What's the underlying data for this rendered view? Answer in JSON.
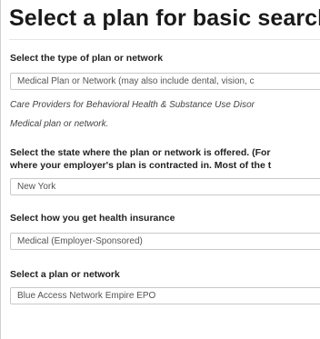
{
  "heading": "Select a plan for basic search",
  "plan_type": {
    "label": "Select the type of plan or network",
    "value": "Medical Plan or Network (may also include dental, vision, c"
  },
  "notes": {
    "line1": "Care Providers for Behavioral Health & Substance Use Disor",
    "line2": "Medical plan or network."
  },
  "state": {
    "label_line1": "Select the state where the plan or network is offered. (For",
    "label_line2": "where your employer's plan is contracted in. Most of the t",
    "value": "New York"
  },
  "insurance_source": {
    "label": "Select how you get health insurance",
    "value": "Medical (Employer-Sponsored)"
  },
  "plan_network": {
    "label": "Select a plan or network",
    "value": "Blue Access Network Empire EPO"
  }
}
